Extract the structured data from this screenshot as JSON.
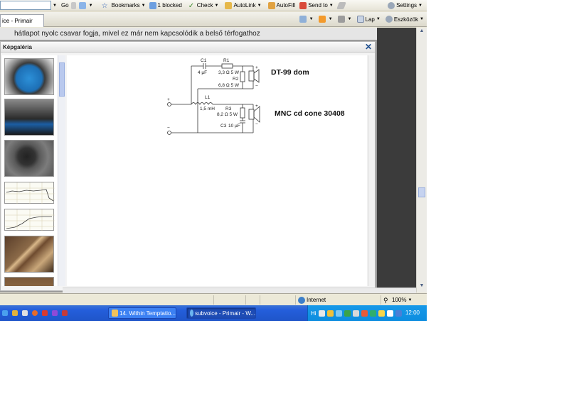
{
  "toolbar": {
    "go_label": "Go",
    "bookmarks_label": "Bookmarks",
    "blocked_label": "1 blocked",
    "check_label": "Check",
    "autolink_label": "AutoLink",
    "autofill_label": "AutoFill",
    "sendto_label": "Send to",
    "settings_label": "Settings"
  },
  "tabs": {
    "active_tab_label": "ice - Primair"
  },
  "commandbar": {
    "page_label": "Lap",
    "tools_label": "Eszközök"
  },
  "content": {
    "article_text": "hátlapot nyolc csavar fogja, mivel ez már nem kapcsolódik a belső térfogathoz"
  },
  "gallery": {
    "title": "Képgaléria",
    "thumbnails": [
      "speaker-blue",
      "speaker-side",
      "dome-tweeter",
      "graph-1",
      "graph-2",
      "wood-panels",
      "wood-panel-2"
    ]
  },
  "schematic": {
    "c1_label": "C1",
    "c1_value": "4 µF",
    "r1_label": "R1",
    "r1_value": "3,3 Ω 5 W",
    "r2_label": "R2",
    "r2_value": "6,8 Ω 5 W",
    "l1_label": "L1",
    "l1_value": "1,5 mH",
    "r3_label": "R3",
    "r3_value": "8,2 Ω 5 W",
    "c3_label": "C3",
    "c3_value": "10 µF",
    "plus_sign": "+",
    "minus_sign": "−",
    "tweeter_label": "DT-99 dom",
    "woofer_label": "MNC cd cone 30408"
  },
  "statusbar": {
    "zone_label": "Internet",
    "zoom_label": "100%"
  },
  "taskbar": {
    "task1_label": "14. Within Temptatio...",
    "task2_label": "subvoice - Primair - W...",
    "tray_prefix": "Hi",
    "clock": "12:00"
  },
  "colors": {
    "taskbar_blue": "#245edb",
    "tray_blue": "#0d8ddf",
    "wire": "#333333"
  }
}
